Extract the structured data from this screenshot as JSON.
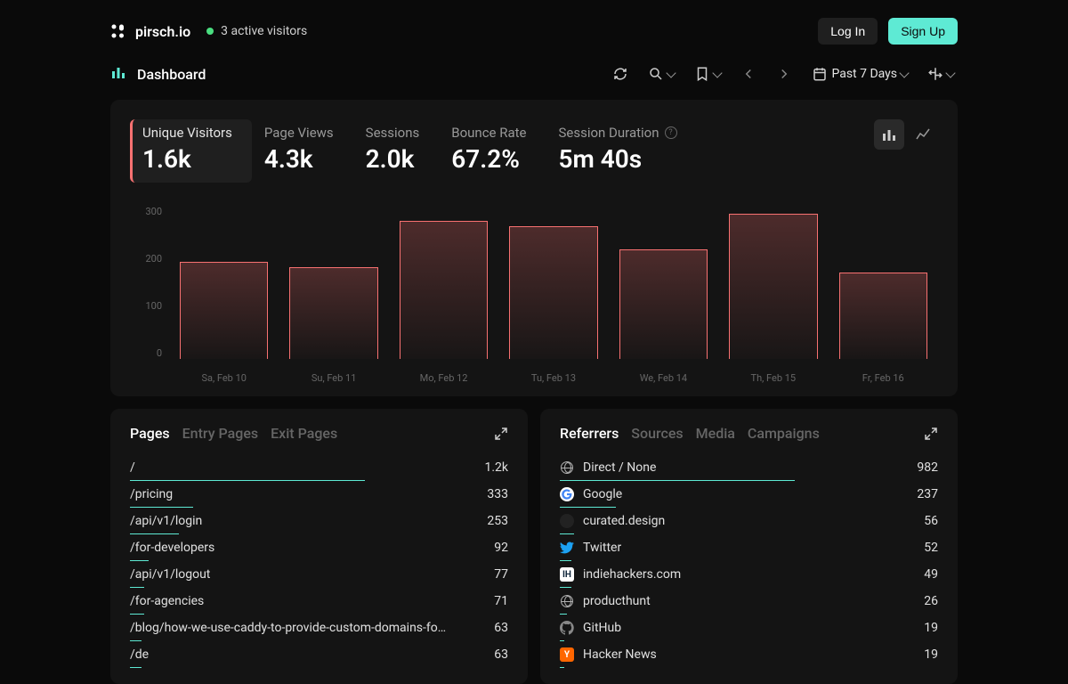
{
  "header": {
    "brand": "pirsch.io",
    "active_visitors": "3 active visitors",
    "login": "Log In",
    "signup": "Sign Up"
  },
  "nav": {
    "title": "Dashboard",
    "range": "Past 7 Days"
  },
  "metrics": [
    {
      "label": "Unique Visitors",
      "value": "1.6k",
      "active": true
    },
    {
      "label": "Page Views",
      "value": "4.3k"
    },
    {
      "label": "Sessions",
      "value": "2.0k"
    },
    {
      "label": "Bounce Rate",
      "value": "67.2%"
    },
    {
      "label": "Session Duration",
      "value": "5m 40s",
      "help": true
    }
  ],
  "chart_data": {
    "type": "bar",
    "categories": [
      "Sa, Feb 10",
      "Su, Feb 11",
      "Mo, Feb 12",
      "Tu, Feb 13",
      "We, Feb 14",
      "Th, Feb 15",
      "Fr, Feb 16"
    ],
    "values": [
      190,
      180,
      270,
      260,
      215,
      285,
      170
    ],
    "title": "Unique Visitors",
    "xlabel": "",
    "ylabel": "",
    "ylim": [
      0,
      300
    ],
    "yticks": [
      0,
      100,
      200,
      300
    ]
  },
  "pages_panel": {
    "tabs": [
      "Pages",
      "Entry Pages",
      "Exit Pages"
    ],
    "active_tab": 0,
    "rows": [
      {
        "path": "/",
        "value": "1.2k",
        "pct": 100
      },
      {
        "path": "/pricing",
        "value": "333",
        "pct": 27
      },
      {
        "path": "/api/v1/login",
        "value": "253",
        "pct": 21
      },
      {
        "path": "/for-developers",
        "value": "92",
        "pct": 8
      },
      {
        "path": "/api/v1/logout",
        "value": "77",
        "pct": 6
      },
      {
        "path": "/for-agencies",
        "value": "71",
        "pct": 6
      },
      {
        "path": "/blog/how-we-use-caddy-to-provide-custom-domains-fo…",
        "value": "63",
        "pct": 5
      },
      {
        "path": "/de",
        "value": "63",
        "pct": 5
      }
    ]
  },
  "referrers_panel": {
    "tabs": [
      "Referrers",
      "Sources",
      "Media",
      "Campaigns"
    ],
    "active_tab": 0,
    "rows": [
      {
        "name": "Direct / None",
        "value": "982",
        "pct": 100,
        "icon": "globe"
      },
      {
        "name": "Google",
        "value": "237",
        "pct": 24,
        "icon": "google"
      },
      {
        "name": "curated.design",
        "value": "56",
        "pct": 6,
        "icon": "dark"
      },
      {
        "name": "Twitter",
        "value": "52",
        "pct": 5,
        "icon": "twitter"
      },
      {
        "name": "indiehackers.com",
        "value": "49",
        "pct": 5,
        "icon": "ih"
      },
      {
        "name": "producthunt",
        "value": "26",
        "pct": 3,
        "icon": "globe"
      },
      {
        "name": "GitHub",
        "value": "19",
        "pct": 2,
        "icon": "github"
      },
      {
        "name": "Hacker News",
        "value": "19",
        "pct": 2,
        "icon": "hn"
      }
    ]
  }
}
